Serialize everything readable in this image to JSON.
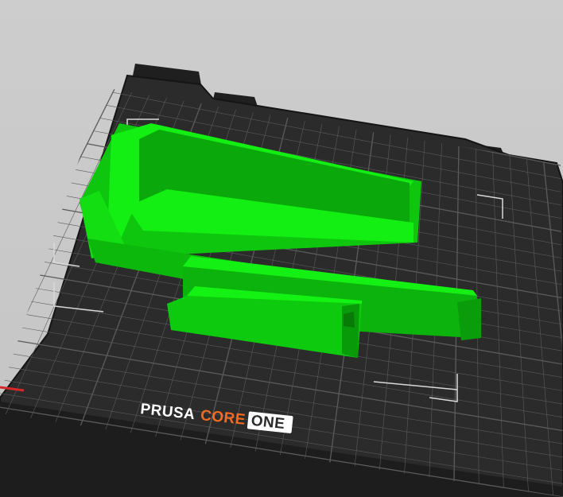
{
  "bed_logo": {
    "word1": "PRUSA",
    "word2": "CORE",
    "word3": "ONE"
  },
  "colors": {
    "background": "#c8c8c8",
    "bed_surface": "#2b2b2b",
    "bed_edge": "#1b1b1b",
    "grid_line": "#5b5b5b",
    "model_light": "#14f214",
    "model_mid": "#0ed00e",
    "model_dark": "#099b09",
    "logo_orange": "#f26b21",
    "logo_white": "#ffffff"
  }
}
